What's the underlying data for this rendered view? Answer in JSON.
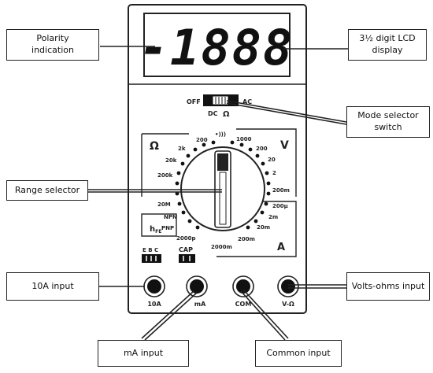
{
  "display": {
    "reading": "-1888"
  },
  "mode_switch": {
    "off": "OFF",
    "ac": "AC",
    "dc": "DC",
    "ohm_symbol": "Ω"
  },
  "dial": {
    "ohm_section": {
      "symbol": "Ω",
      "ranges": [
        "200",
        "2k",
        "20k",
        "200k",
        "20M"
      ]
    },
    "volt_section": {
      "symbol": "V",
      "ranges": [
        "1000",
        "200",
        "20",
        "2",
        "200m"
      ]
    },
    "amp_section": {
      "symbol": "A",
      "ranges": [
        "200μ",
        "2m",
        "20m",
        "200m",
        "2000m"
      ]
    },
    "hfe_section": {
      "symbol": "hFE",
      "ranges": [
        "NPN",
        "PNP"
      ]
    },
    "cap_ranges": [
      "2000p"
    ],
    "continuity_symbol": "•)))"
  },
  "sockets": {
    "transistor_label": "E B C",
    "cap_label": "CAP",
    "jacks": [
      "10A",
      "mA",
      "COM",
      "V-Ω"
    ]
  },
  "callouts": {
    "polarity": [
      "Polarity",
      "indication"
    ],
    "lcd": [
      "3½ digit LCD",
      "display"
    ],
    "mode": [
      "Mode selector",
      "switch"
    ],
    "range": [
      "Range selector"
    ],
    "tenA": [
      "10A input"
    ],
    "ma": [
      "mA input"
    ],
    "common": [
      "Common input"
    ],
    "volts": [
      "Volts-ohms input"
    ]
  },
  "colors": {
    "ink": "#222222",
    "panel": "#ffffff",
    "lcd_text": "#111111"
  }
}
